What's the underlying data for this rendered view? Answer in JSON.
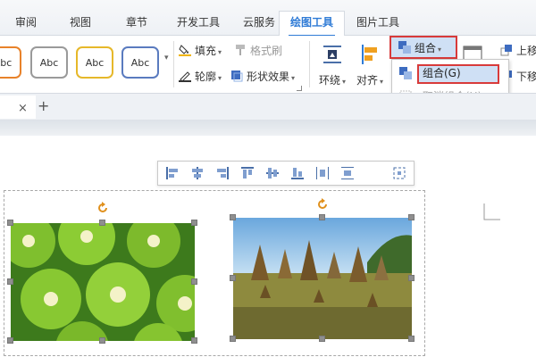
{
  "tabs": [
    {
      "label": "审阅",
      "active": false
    },
    {
      "label": "视图",
      "active": false
    },
    {
      "label": "章节",
      "active": false
    },
    {
      "label": "开发工具",
      "active": false
    },
    {
      "label": "云服务",
      "active": false
    },
    {
      "label": "绘图工具",
      "active": true
    },
    {
      "label": "图片工具",
      "active": false
    }
  ],
  "ribbon": {
    "styles": [
      "Abc",
      "Abc",
      "Abc",
      "Abc"
    ],
    "style_colors": [
      "#e8822a",
      "#9a9a9a",
      "#e6b82a",
      "#5a7bbf"
    ],
    "fill_label": "填充",
    "format_brush_label": "格式刷",
    "outline_label": "轮廓",
    "shape_effect_label": "形状效果",
    "wrap_label": "环绕",
    "align_label": "对齐",
    "group_label": "组合",
    "up_label": "上移",
    "down_label": "下移"
  },
  "group_menu": {
    "items": [
      {
        "label": "组合(G)",
        "enabled": true,
        "highlighted": true
      },
      {
        "label": "取消组合(U)",
        "enabled": false,
        "highlighted": false
      }
    ]
  },
  "doc_tab": {
    "close_symbol": "×",
    "new_symbol": "+"
  },
  "align_toolbar": {
    "icons": [
      "align-left-icon",
      "align-center-icon",
      "align-right-icon",
      "align-top-icon",
      "align-middle-icon",
      "align-bottom-icon",
      "distribute-horizontal-icon",
      "distribute-vertical-icon",
      "more-options-icon"
    ]
  },
  "images": [
    {
      "name": "kiwi-image",
      "subject": "kiwi slices"
    },
    {
      "name": "field-image",
      "subject": "haystacks in a field"
    }
  ],
  "colors": {
    "accent": "#2f7bd6",
    "highlight_border": "#d83a3a",
    "highlight_fill": "#cfe0f5"
  }
}
